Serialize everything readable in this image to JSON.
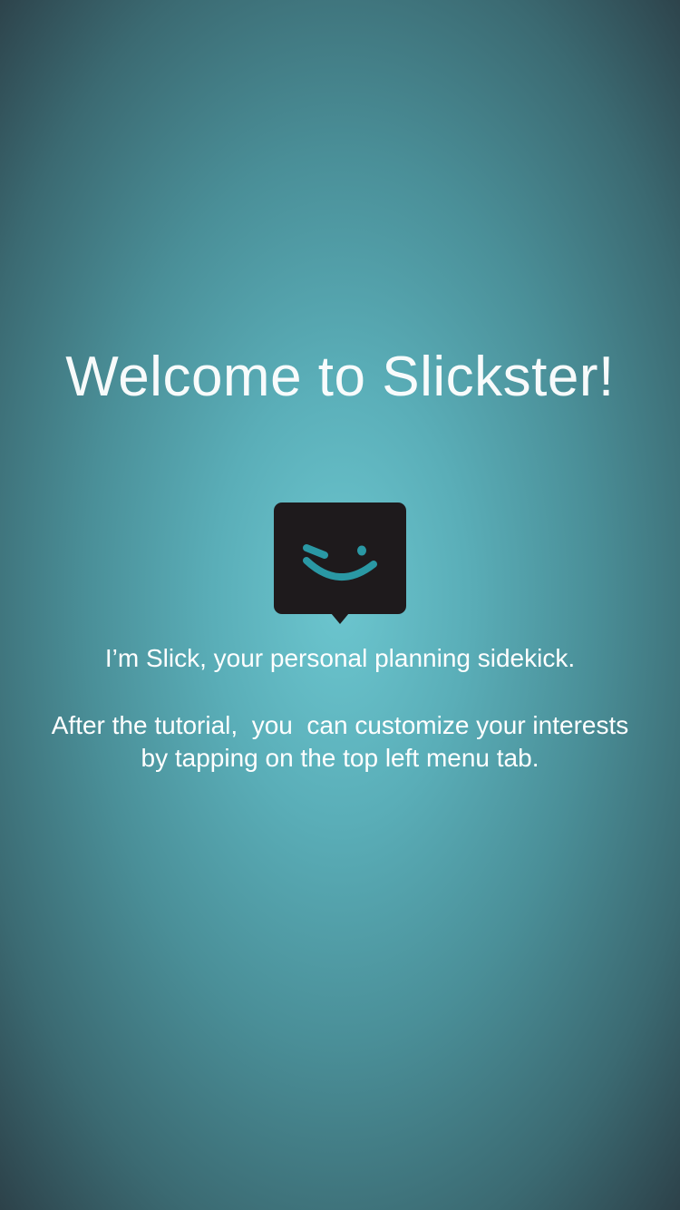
{
  "onboarding": {
    "title": "Welcome to Slickster!",
    "logo_icon": "winking-chat-bubble-icon",
    "intro": "I’m Slick, your personal planning sidekick.",
    "tip_line1": "After the tutorial,  you  can customize your interests",
    "tip_line2": "by tapping on the top left menu tab."
  },
  "colors": {
    "logo_bubble": "#1e1a1c",
    "logo_face": "#2a98a4",
    "text": "#ffffff",
    "background_center": "#6cc6cf",
    "background_edge": "#2a3a42"
  }
}
